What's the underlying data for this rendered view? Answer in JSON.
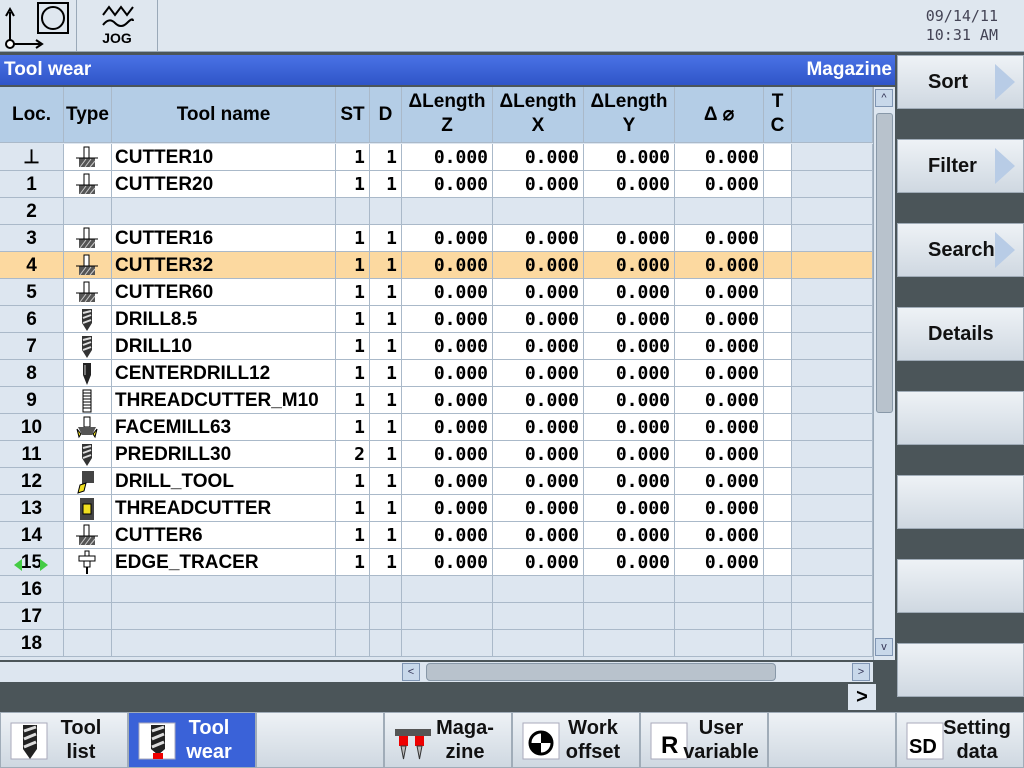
{
  "header": {
    "mode": "JOG",
    "date": "09/14/11",
    "time": "10:31 AM"
  },
  "title": {
    "left": "Tool wear",
    "right": "Magazine"
  },
  "columns": [
    "Loc.",
    "Type",
    "Tool name",
    "ST",
    "D",
    "ΔLength Z",
    "ΔLength X",
    "ΔLength Y",
    "Δ ⌀",
    "T C"
  ],
  "column_lines": {
    "dlz": [
      "ΔLength",
      "Z"
    ],
    "dlx": [
      "ΔLength",
      "X"
    ],
    "dly": [
      "ΔLength",
      "Y"
    ],
    "tc": [
      "T",
      "C"
    ]
  },
  "rows": [
    {
      "loc": "⊥",
      "type": "cutter",
      "name": "CUTTER10",
      "st": "1",
      "d": "1",
      "z": "0.000",
      "x": "0.000",
      "y": "0.000",
      "dia": "0.000"
    },
    {
      "loc": "1",
      "type": "cutter",
      "name": "CUTTER20",
      "st": "1",
      "d": "1",
      "z": "0.000",
      "x": "0.000",
      "y": "0.000",
      "dia": "0.000"
    },
    {
      "loc": "2"
    },
    {
      "loc": "3",
      "type": "cutter",
      "name": "CUTTER16",
      "st": "1",
      "d": "1",
      "z": "0.000",
      "x": "0.000",
      "y": "0.000",
      "dia": "0.000"
    },
    {
      "loc": "4",
      "type": "cutter",
      "name": "CUTTER32",
      "st": "1",
      "d": "1",
      "z": "0.000",
      "x": "0.000",
      "y": "0.000",
      "dia": "0.000",
      "selected": true
    },
    {
      "loc": "5",
      "type": "cutter",
      "name": "CUTTER60",
      "st": "1",
      "d": "1",
      "z": "0.000",
      "x": "0.000",
      "y": "0.000",
      "dia": "0.000"
    },
    {
      "loc": "6",
      "type": "drill",
      "name": "DRILL8.5",
      "st": "1",
      "d": "1",
      "z": "0.000",
      "x": "0.000",
      "y": "0.000",
      "dia": "0.000"
    },
    {
      "loc": "7",
      "type": "drill",
      "name": "DRILL10",
      "st": "1",
      "d": "1",
      "z": "0.000",
      "x": "0.000",
      "y": "0.000",
      "dia": "0.000"
    },
    {
      "loc": "8",
      "type": "centerdrill",
      "name": "CENTERDRILL12",
      "st": "1",
      "d": "1",
      "z": "0.000",
      "x": "0.000",
      "y": "0.000",
      "dia": "0.000"
    },
    {
      "loc": "9",
      "type": "threadcutter",
      "name": "THREADCUTTER_M10",
      "st": "1",
      "d": "1",
      "z": "0.000",
      "x": "0.000",
      "y": "0.000",
      "dia": "0.000"
    },
    {
      "loc": "10",
      "type": "facemill",
      "name": "FACEMILL63",
      "st": "1",
      "d": "1",
      "z": "0.000",
      "x": "0.000",
      "y": "0.000",
      "dia": "0.000"
    },
    {
      "loc": "11",
      "type": "drill",
      "name": "PREDRILL30",
      "st": "2",
      "d": "1",
      "z": "0.000",
      "x": "0.000",
      "y": "0.000",
      "dia": "0.000"
    },
    {
      "loc": "12",
      "type": "turning",
      "name": "DRILL_TOOL",
      "st": "1",
      "d": "1",
      "z": "0.000",
      "x": "0.000",
      "y": "0.000",
      "dia": "0.000"
    },
    {
      "loc": "13",
      "type": "turning-thread",
      "name": "THREADCUTTER",
      "st": "1",
      "d": "1",
      "z": "0.000",
      "x": "0.000",
      "y": "0.000",
      "dia": "0.000"
    },
    {
      "loc": "14",
      "type": "cutter",
      "name": "CUTTER6",
      "st": "1",
      "d": "1",
      "z": "0.000",
      "x": "0.000",
      "y": "0.000",
      "dia": "0.000"
    },
    {
      "loc": "15",
      "type": "edge-tracer",
      "name": "EDGE_TRACER",
      "st": "1",
      "d": "1",
      "z": "0.000",
      "x": "0.000",
      "y": "0.000",
      "dia": "0.000"
    },
    {
      "loc": "16"
    },
    {
      "loc": "17"
    },
    {
      "loc": "18"
    }
  ],
  "right_softkeys": [
    "Sort",
    "Filter",
    "Search",
    "Details",
    "",
    "",
    "",
    ""
  ],
  "bottom_softkeys": [
    [
      "Tool",
      "list"
    ],
    [
      "Tool",
      "wear"
    ],
    [
      "",
      ""
    ],
    [
      "Maga-",
      "zine"
    ],
    [
      "Work",
      "offset"
    ],
    [
      "User",
      "variable"
    ],
    [
      "",
      ""
    ],
    [
      "Setting",
      "data"
    ]
  ],
  "more_label": ">",
  "colors": {
    "title_bar": "#3a62d8",
    "selected_row": "#fcd9a0",
    "header": "#b4cde6"
  }
}
